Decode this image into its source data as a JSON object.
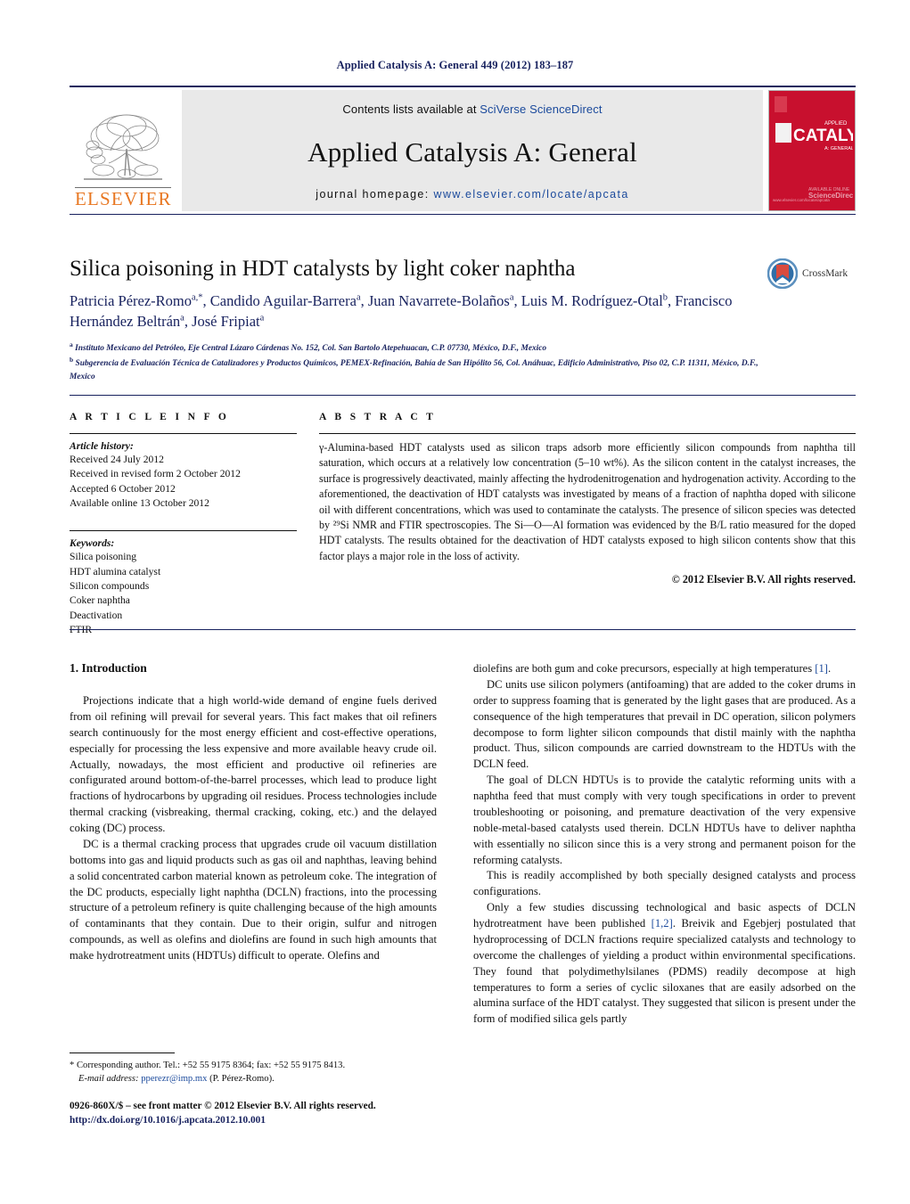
{
  "running_head": "Applied Catalysis A: General 449 (2012) 183–187",
  "masthead": {
    "publisher_name": "ELSEVIER",
    "contents_prefix": "Contents lists available at ",
    "contents_link": "SciVerse ScienceDirect",
    "journal_title": "Applied Catalysis A: General",
    "homepage_prefix": "journal homepage:",
    "homepage_url": "www.elsevier.com/locate/apcata",
    "cover_alt_title": "APPLIED CATALYSIS A: GENERAL",
    "cover_color": "#c8102e",
    "elsevier_orange": "#e87722"
  },
  "article": {
    "title": "Silica poisoning in HDT catalysts by light coker naphtha",
    "authors_html": "Patricia Pérez-Romo<sup>a,*</sup>, Candido Aguilar-Barrera<sup>a</sup>, Juan Navarrete-Bolaños<sup>a</sup>, Luis M. Rodríguez-Otal<sup>b</sup>, Francisco Hernández Beltrán<sup>a</sup>, José Fripiat<sup>a</sup>",
    "affiliation_a": "Instituto Mexicano del Petróleo, Eje Central Lázaro Cárdenas No. 152, Col. San Bartolo Atepehuacan, C.P. 07730, México, D.F., Mexico",
    "affiliation_b": "Subgerencia de Evaluación Técnica de Catalizadores y Productos Químicos, PEMEX-Refinación, Bahía de San Hipólito 56, Col. Anáhuac, Edificio Administrativo, Piso 02, C.P. 11311, México, D.F., Mexico",
    "crossmark_label": "CrossMark"
  },
  "article_info": {
    "heading": "A R T I C L E  I N F O",
    "history_title": "Article history:",
    "history": [
      "Received 24 July 2012",
      "Received in revised form 2 October 2012",
      "Accepted 6 October 2012",
      "Available online 13 October 2012"
    ],
    "keywords_title": "Keywords:",
    "keywords": [
      "Silica poisoning",
      "HDT alumina catalyst",
      "Silicon compounds",
      "Coker naphtha",
      "Deactivation",
      "FTIR"
    ]
  },
  "abstract": {
    "heading": "A B S T R A C T",
    "text": "γ-Alumina-based HDT catalysts used as silicon traps adsorb more efficiently silicon compounds from naphtha till saturation, which occurs at a relatively low concentration (5–10 wt%). As the silicon content in the catalyst increases, the surface is progressively deactivated, mainly affecting the hydrodenitrogenation and hydrogenation activity. According to the aforementioned, the deactivation of HDT catalysts was investigated by means of a fraction of naphtha doped with silicone oil with different concentrations, which was used to contaminate the catalysts. The presence of silicon species was detected by ²⁹Si NMR and FTIR spectroscopies. The Si—O—Al formation was evidenced by the B/L ratio measured for the doped HDT catalysts. The results obtained for the deactivation of HDT catalysts exposed to high silicon contents show that this factor plays a major role in the loss of activity.",
    "copyright": "© 2012 Elsevier B.V. All rights reserved."
  },
  "body": {
    "section_heading": "1. Introduction",
    "left_paragraphs": [
      "Projections indicate that a high world-wide demand of engine fuels derived from oil refining will prevail for several years. This fact makes that oil refiners search continuously for the most energy efficient and cost-effective operations, especially for processing the less expensive and more available heavy crude oil. Actually, nowadays, the most efficient and productive oil refineries are configurated around bottom-of-the-barrel processes, which lead to produce light fractions of hydrocarbons by upgrading oil residues. Process technologies include thermal cracking (visbreaking, thermal cracking, coking, etc.) and the delayed coking (DC) process.",
      "DC is a thermal cracking process that upgrades crude oil vacuum distillation bottoms into gas and liquid products such as gas oil and naphthas, leaving behind a solid concentrated carbon material known as petroleum coke. The integration of the DC products, especially light naphtha (DCLN) fractions, into the processing structure of a petroleum refinery is quite challenging because of the high amounts of contaminants that they contain. Due to their origin, sulfur and nitrogen compounds, as well as olefins and diolefins are found in such high amounts that make hydrotreatment units (HDTUs) difficult to operate. Olefins and"
    ],
    "right_paragraphs": [
      {
        "before": "diolefins are both gum and coke precursors, especially at high temperatures ",
        "ref": "[1]",
        "after": "."
      },
      {
        "before": "DC units use silicon polymers (antifoaming) that are added to the coker drums in order to suppress foaming that is generated by the light gases that are produced. As a consequence of the high temperatures that prevail in DC operation, silicon polymers decompose to form lighter silicon compounds that distil mainly with the naphtha product. Thus, silicon compounds are carried downstream to the HDTUs with the DCLN feed.",
        "ref": "",
        "after": ""
      },
      {
        "before": "The goal of DLCN HDTUs is to provide the catalytic reforming units with a naphtha feed that must comply with very tough specifications in order to prevent troubleshooting or poisoning, and premature deactivation of the very expensive noble-metal-based catalysts used therein. DCLN HDTUs have to deliver naphtha with essentially no silicon since this is a very strong and permanent poison for the reforming catalysts.",
        "ref": "",
        "after": ""
      },
      {
        "before": "This is readily accomplished by both specially designed catalysts and process configurations.",
        "ref": "",
        "after": ""
      },
      {
        "before": "Only a few studies discussing technological and basic aspects of DCLN hydrotreatment have been published ",
        "ref": "[1,2]",
        "after": ". Breivik and Egebjerj postulated that hydroprocessing of DCLN fractions require specialized catalysts and technology to overcome the challenges of yielding a product within environmental specifications. They found that polydimethylsilanes (PDMS) readily decompose at high temperatures to form a series of cyclic siloxanes that are easily adsorbed on the alumina surface of the HDT catalyst. They suggested that silicon is present under the form of modified silica gels partly"
      }
    ]
  },
  "footer": {
    "corresponding_marker": "*",
    "corresponding_text": "Corresponding author. Tel.: +52 55 9175 8364; fax: +52 55 9175 8413.",
    "email_label": "E-mail address:",
    "email": "pperezr@imp.mx",
    "email_owner": "(P. Pérez-Romo).",
    "issn_line": "0926-860X/$ – see front matter © 2012 Elsevier B.V. All rights reserved.",
    "doi_line": "http://dx.doi.org/10.1016/j.apcata.2012.10.001"
  }
}
